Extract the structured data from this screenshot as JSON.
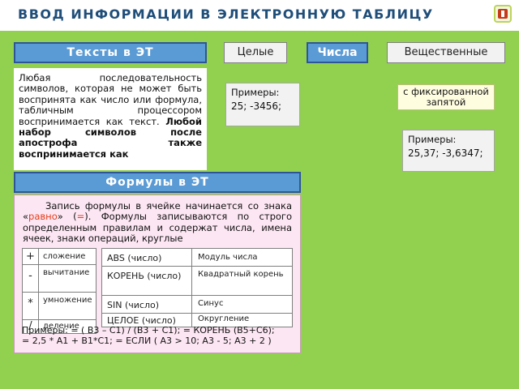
{
  "header": {
    "title": "ВВОД ИНФОРМАЦИИ В ЭЛЕКТРОННУЮ ТАБЛИЦУ"
  },
  "texts": {
    "title": "Тексты в ЭТ",
    "body_part1": "Любая последовательность символов, которая не может быть воспринята как число или формула, табличным процессором воспринимается как текст. ",
    "body_bold": "Любой набор символов после апострофа также воспринимается как"
  },
  "numbers": {
    "tab_int": "Целые",
    "tab_numbers": "Числа",
    "tab_real": "Вещественные",
    "int_examples_label": "Примеры:",
    "int_examples_value": "25; -3456;",
    "fixed_point": "с фиксированной запятой",
    "real_examples_label": "Примеры:",
    "real_examples_value": "25,37; -3,6347;"
  },
  "formulas": {
    "title": "Формулы в ЭТ",
    "desc_part1": "Запись формулы в ячейке начинается со знака «",
    "desc_eq_word": "равно",
    "desc_part2": "» (",
    "desc_eq_sign": "=",
    "desc_part3": "). Формулы записываются по строго определенным правилам и содержат числа, имена ячеек, знаки операций, круглые",
    "operators": [
      {
        "sign": "+",
        "name": "сложение"
      },
      {
        "sign": "-",
        "name": "вычитание"
      },
      {
        "sign": "*",
        "name": "умножение"
      },
      {
        "sign": "/",
        "name": "деление"
      }
    ],
    "functions": [
      {
        "func": "ABS (число)",
        "desc": "Модуль числа"
      },
      {
        "func": "КОРЕНЬ (число)",
        "desc": "Квадратный корень"
      },
      {
        "func": "SIN (число)",
        "desc": "Синус"
      },
      {
        "func": "ЦЕЛОЕ (число)",
        "desc": "Округление"
      }
    ],
    "examples_line1": "Примеры: = ( B3 – C1) / (B3 + C1); = КОРЕНЬ (B5+C6);",
    "examples_line2": "= 2,5 * A1 + B1*C1; = ЕСЛИ ( A3 > 10; A3 - 5; A3 + 2 )"
  },
  "colors": {
    "background": "#92d050",
    "title_blue": "#5b9bd5",
    "header_text": "#1f4e79",
    "accent_red": "#e23f1a"
  },
  "icons": {
    "home": "home-icon"
  }
}
